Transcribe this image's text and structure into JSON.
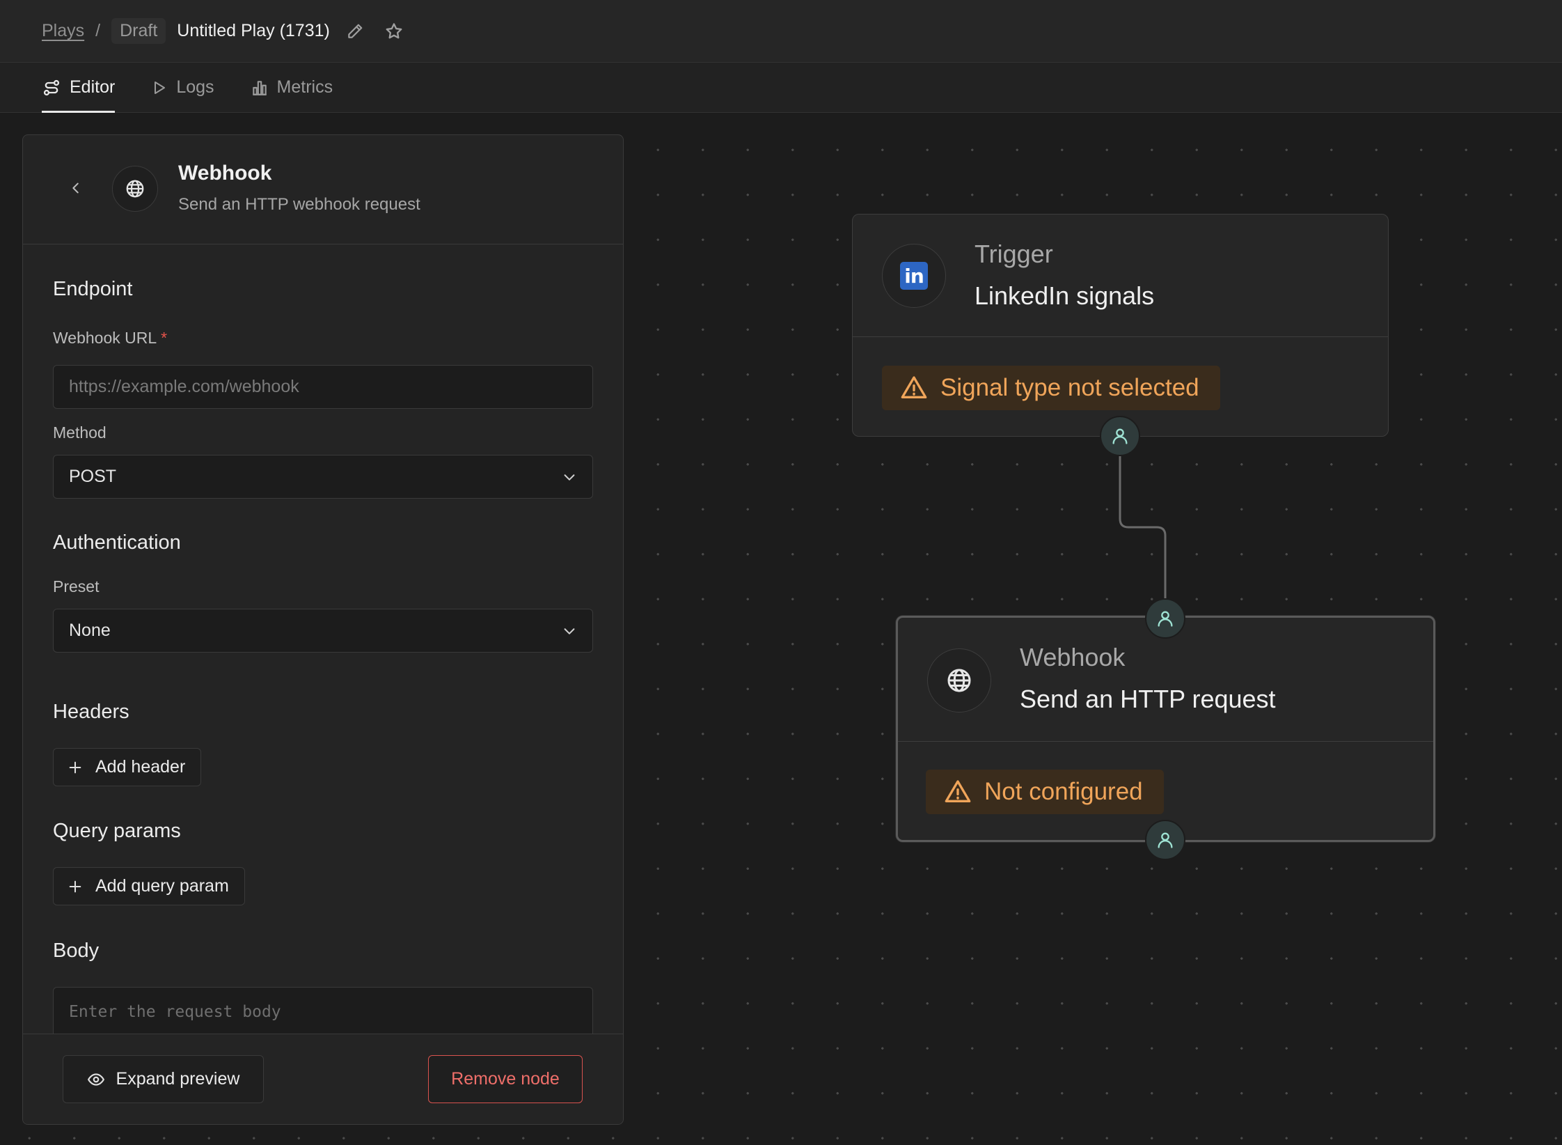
{
  "breadcrumb": {
    "root": "Plays",
    "separator": "/",
    "status": "Draft",
    "title": "Untitled Play (1731)"
  },
  "tabs": [
    {
      "label": "Editor",
      "icon": "editor-flow-icon",
      "active": true
    },
    {
      "label": "Logs",
      "icon": "play-icon",
      "active": false
    },
    {
      "label": "Metrics",
      "icon": "bar-chart-icon",
      "active": false
    }
  ],
  "panel": {
    "title": "Webhook",
    "subtitle": "Send an HTTP webhook request",
    "endpoint": {
      "section": "Endpoint",
      "url_label": "Webhook URL",
      "url_required_mark": "*",
      "url_placeholder": "https://example.com/webhook",
      "method_label": "Method",
      "method_value": "POST"
    },
    "authentication": {
      "section": "Authentication",
      "preset_label": "Preset",
      "preset_value": "None"
    },
    "headers": {
      "section": "Headers",
      "add_label": "Add header"
    },
    "query_params": {
      "section": "Query params",
      "add_label": "Add query param"
    },
    "body": {
      "section": "Body",
      "placeholder": "Enter the request body"
    },
    "footer": {
      "expand_label": "Expand preview",
      "remove_label": "Remove node"
    }
  },
  "flow": {
    "trigger_node": {
      "kind": "Trigger",
      "name": "LinkedIn signals",
      "icon_text": "in",
      "warning": "Signal type not selected"
    },
    "webhook_node": {
      "kind": "Webhook",
      "name": "Send an HTTP request",
      "warning": "Not configured"
    }
  },
  "colors": {
    "background": "#1a1a1a",
    "warning_bg": "#3a2c1c",
    "warning_text": "#f0a55a",
    "danger": "#e5534b",
    "linkedin": "#2d66c3"
  }
}
